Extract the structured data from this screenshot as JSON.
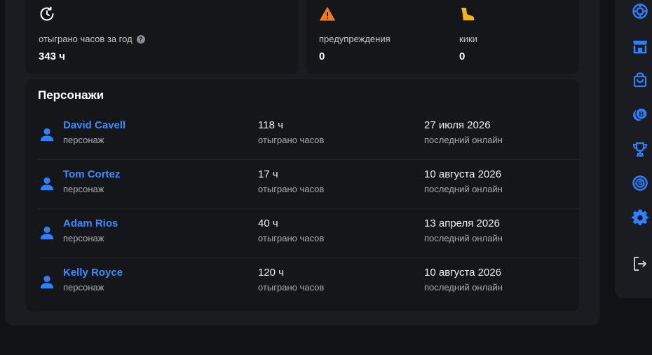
{
  "stats": {
    "hours_label": "отыграно часов за год",
    "hours_value": "343 ч",
    "warnings_label": "предупреждения",
    "warnings_value": "0",
    "kicks_label": "кики",
    "kicks_value": "0",
    "help_glyph": "?"
  },
  "characters": {
    "title": "Персонажи",
    "rows": [
      {
        "name": "David Cavell",
        "type": "персонаж",
        "hours": "118 ч",
        "hours_label": "отыграно часов",
        "last_online": "27 июля 2026",
        "last_online_label": "последний онлайн"
      },
      {
        "name": "Tom Cortez",
        "type": "персонаж",
        "hours": "17 ч",
        "hours_label": "отыграно часов",
        "last_online": "10 августа 2026",
        "last_online_label": "последний онлайн"
      },
      {
        "name": "Adam Rios",
        "type": "персонаж",
        "hours": "40 ч",
        "hours_label": "отыграно часов",
        "last_online": "13 апреля 2026",
        "last_online_label": "последний онлайн"
      },
      {
        "name": "Kelly Royce",
        "type": "персонаж",
        "hours": "120 ч",
        "hours_label": "отыграно часов",
        "last_online": "10 августа 2026",
        "last_online_label": "последний онлайн"
      }
    ]
  },
  "sidebar_icons": [
    "casino-chip-icon",
    "store-icon",
    "shopping-bag-icon",
    "coins-icon",
    "trophy-icon",
    "badge-icon",
    "settings-gear-icon",
    "logout-icon"
  ],
  "colors": {
    "accent": "#2e80ff",
    "link": "#3d8cff",
    "warning": "#f07a1e",
    "kick": "#f5b21f"
  }
}
